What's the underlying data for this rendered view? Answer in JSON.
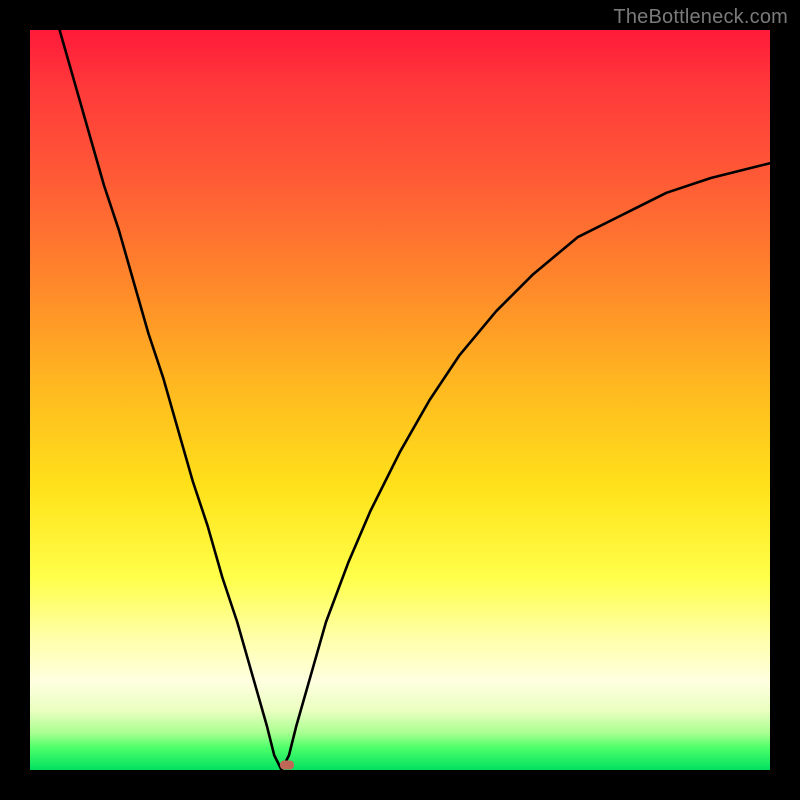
{
  "watermark": "TheBottleneck.com",
  "colors": {
    "background_frame": "#000000",
    "watermark_text": "#7a7a7a",
    "curve_stroke": "#000000",
    "marker_fill": "#c06858",
    "gradient_top": "#ff1a3a",
    "gradient_bottom": "#02e060"
  },
  "chart_data": {
    "type": "line",
    "title": "",
    "xlabel": "",
    "ylabel": "",
    "x_range": [
      0,
      100
    ],
    "y_range": [
      0,
      100
    ],
    "note": "Axes are abstract percent scales inferred from plot extents; no tick labels are rendered in the image. y≈0 at the bottom (green) and y≈100 at the top (red). The curve is a V-shape with its minimum near x≈34.",
    "series": [
      {
        "name": "left-branch",
        "x": [
          4,
          6,
          8,
          10,
          12,
          14,
          16,
          18,
          20,
          22,
          24,
          26,
          28,
          30,
          32,
          33,
          34
        ],
        "y": [
          100,
          93,
          86,
          79,
          73,
          66,
          59,
          53,
          46,
          39,
          33,
          26,
          20,
          13,
          6,
          2,
          0
        ]
      },
      {
        "name": "right-branch",
        "x": [
          34,
          35,
          36,
          38,
          40,
          43,
          46,
          50,
          54,
          58,
          63,
          68,
          74,
          80,
          86,
          92,
          100
        ],
        "y": [
          0,
          2,
          6,
          13,
          20,
          28,
          35,
          43,
          50,
          56,
          62,
          67,
          72,
          75,
          78,
          80,
          82
        ]
      }
    ],
    "marker": {
      "x": 34.7,
      "y": 0.7,
      "shape": "rounded-rect",
      "color": "#c06858"
    },
    "grid": false,
    "legend": false
  }
}
